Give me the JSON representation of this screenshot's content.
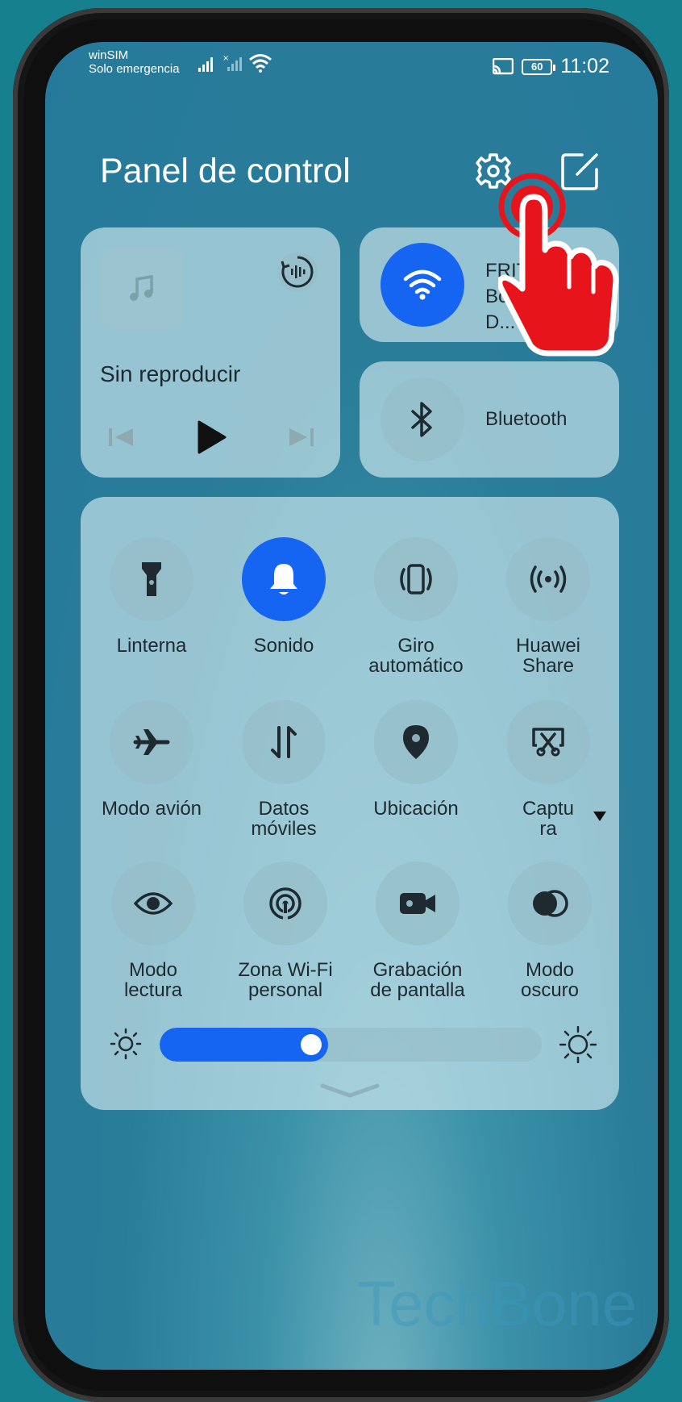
{
  "status_bar": {
    "carrier": "winSIM",
    "network_status": "Solo emergencia",
    "battery": "60",
    "time": "11:02",
    "icons": [
      "signal-icon",
      "signal-no-sim-icon",
      "wifi-status-icon",
      "cast-icon",
      "battery-icon"
    ]
  },
  "header": {
    "title": "Panel de control",
    "settings_icon": "gear-icon",
    "edit_icon": "edit-icon"
  },
  "media": {
    "status": "Sin reproducir",
    "icons": [
      "music-note-icon",
      "audio-output-icon",
      "previous-icon",
      "play-icon",
      "next-icon"
    ]
  },
  "wifi_tile": {
    "label": "FRITZ!\nBox D...",
    "icon": "wifi-icon",
    "active": true,
    "color": "#1565f2"
  },
  "bluetooth_tile": {
    "label": "Bluetooth",
    "icon": "bluetooth-icon",
    "active": false
  },
  "toggles": [
    {
      "label": "Linterna",
      "icon": "flashlight-icon",
      "active": false
    },
    {
      "label": "Sonido",
      "icon": "bell-icon",
      "active": true
    },
    {
      "label": "Giro\nautomático",
      "icon": "auto-rotate-icon",
      "active": false
    },
    {
      "label": "Huawei\nShare",
      "icon": "huawei-share-icon",
      "active": false
    },
    {
      "label": "Modo avión",
      "icon": "airplane-icon",
      "active": false
    },
    {
      "label": "Datos\nmóviles",
      "icon": "mobile-data-icon",
      "active": false
    },
    {
      "label": "Ubicación",
      "icon": "location-icon",
      "active": false
    },
    {
      "label": "Captu\nra",
      "icon": "screenshot-icon",
      "active": false
    },
    {
      "label": "Modo\nlectura",
      "icon": "eye-icon",
      "active": false
    },
    {
      "label": "Zona Wi-Fi\npersonal",
      "icon": "hotspot-icon",
      "active": false
    },
    {
      "label": "Grabación\nde pantalla",
      "icon": "screen-record-icon",
      "active": false
    },
    {
      "label": "Modo\noscuro",
      "icon": "dark-mode-icon",
      "active": false
    }
  ],
  "brightness": {
    "level": 0.44
  },
  "watermark": "TechBone",
  "colors": {
    "accent": "#1565f2",
    "background": "#17808f",
    "pointer": "#e8141c"
  }
}
